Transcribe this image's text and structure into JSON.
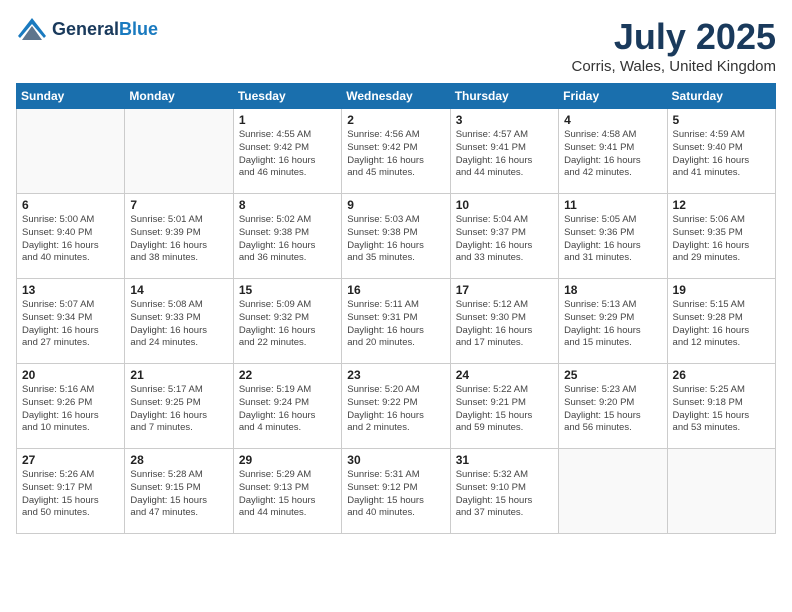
{
  "header": {
    "logo_general": "General",
    "logo_blue": "Blue",
    "month_year": "July 2025",
    "location": "Corris, Wales, United Kingdom"
  },
  "weekdays": [
    "Sunday",
    "Monday",
    "Tuesday",
    "Wednesday",
    "Thursday",
    "Friday",
    "Saturday"
  ],
  "weeks": [
    [
      {
        "day": "",
        "info": ""
      },
      {
        "day": "",
        "info": ""
      },
      {
        "day": "1",
        "info": "Sunrise: 4:55 AM\nSunset: 9:42 PM\nDaylight: 16 hours\nand 46 minutes."
      },
      {
        "day": "2",
        "info": "Sunrise: 4:56 AM\nSunset: 9:42 PM\nDaylight: 16 hours\nand 45 minutes."
      },
      {
        "day": "3",
        "info": "Sunrise: 4:57 AM\nSunset: 9:41 PM\nDaylight: 16 hours\nand 44 minutes."
      },
      {
        "day": "4",
        "info": "Sunrise: 4:58 AM\nSunset: 9:41 PM\nDaylight: 16 hours\nand 42 minutes."
      },
      {
        "day": "5",
        "info": "Sunrise: 4:59 AM\nSunset: 9:40 PM\nDaylight: 16 hours\nand 41 minutes."
      }
    ],
    [
      {
        "day": "6",
        "info": "Sunrise: 5:00 AM\nSunset: 9:40 PM\nDaylight: 16 hours\nand 40 minutes."
      },
      {
        "day": "7",
        "info": "Sunrise: 5:01 AM\nSunset: 9:39 PM\nDaylight: 16 hours\nand 38 minutes."
      },
      {
        "day": "8",
        "info": "Sunrise: 5:02 AM\nSunset: 9:38 PM\nDaylight: 16 hours\nand 36 minutes."
      },
      {
        "day": "9",
        "info": "Sunrise: 5:03 AM\nSunset: 9:38 PM\nDaylight: 16 hours\nand 35 minutes."
      },
      {
        "day": "10",
        "info": "Sunrise: 5:04 AM\nSunset: 9:37 PM\nDaylight: 16 hours\nand 33 minutes."
      },
      {
        "day": "11",
        "info": "Sunrise: 5:05 AM\nSunset: 9:36 PM\nDaylight: 16 hours\nand 31 minutes."
      },
      {
        "day": "12",
        "info": "Sunrise: 5:06 AM\nSunset: 9:35 PM\nDaylight: 16 hours\nand 29 minutes."
      }
    ],
    [
      {
        "day": "13",
        "info": "Sunrise: 5:07 AM\nSunset: 9:34 PM\nDaylight: 16 hours\nand 27 minutes."
      },
      {
        "day": "14",
        "info": "Sunrise: 5:08 AM\nSunset: 9:33 PM\nDaylight: 16 hours\nand 24 minutes."
      },
      {
        "day": "15",
        "info": "Sunrise: 5:09 AM\nSunset: 9:32 PM\nDaylight: 16 hours\nand 22 minutes."
      },
      {
        "day": "16",
        "info": "Sunrise: 5:11 AM\nSunset: 9:31 PM\nDaylight: 16 hours\nand 20 minutes."
      },
      {
        "day": "17",
        "info": "Sunrise: 5:12 AM\nSunset: 9:30 PM\nDaylight: 16 hours\nand 17 minutes."
      },
      {
        "day": "18",
        "info": "Sunrise: 5:13 AM\nSunset: 9:29 PM\nDaylight: 16 hours\nand 15 minutes."
      },
      {
        "day": "19",
        "info": "Sunrise: 5:15 AM\nSunset: 9:28 PM\nDaylight: 16 hours\nand 12 minutes."
      }
    ],
    [
      {
        "day": "20",
        "info": "Sunrise: 5:16 AM\nSunset: 9:26 PM\nDaylight: 16 hours\nand 10 minutes."
      },
      {
        "day": "21",
        "info": "Sunrise: 5:17 AM\nSunset: 9:25 PM\nDaylight: 16 hours\nand 7 minutes."
      },
      {
        "day": "22",
        "info": "Sunrise: 5:19 AM\nSunset: 9:24 PM\nDaylight: 16 hours\nand 4 minutes."
      },
      {
        "day": "23",
        "info": "Sunrise: 5:20 AM\nSunset: 9:22 PM\nDaylight: 16 hours\nand 2 minutes."
      },
      {
        "day": "24",
        "info": "Sunrise: 5:22 AM\nSunset: 9:21 PM\nDaylight: 15 hours\nand 59 minutes."
      },
      {
        "day": "25",
        "info": "Sunrise: 5:23 AM\nSunset: 9:20 PM\nDaylight: 15 hours\nand 56 minutes."
      },
      {
        "day": "26",
        "info": "Sunrise: 5:25 AM\nSunset: 9:18 PM\nDaylight: 15 hours\nand 53 minutes."
      }
    ],
    [
      {
        "day": "27",
        "info": "Sunrise: 5:26 AM\nSunset: 9:17 PM\nDaylight: 15 hours\nand 50 minutes."
      },
      {
        "day": "28",
        "info": "Sunrise: 5:28 AM\nSunset: 9:15 PM\nDaylight: 15 hours\nand 47 minutes."
      },
      {
        "day": "29",
        "info": "Sunrise: 5:29 AM\nSunset: 9:13 PM\nDaylight: 15 hours\nand 44 minutes."
      },
      {
        "day": "30",
        "info": "Sunrise: 5:31 AM\nSunset: 9:12 PM\nDaylight: 15 hours\nand 40 minutes."
      },
      {
        "day": "31",
        "info": "Sunrise: 5:32 AM\nSunset: 9:10 PM\nDaylight: 15 hours\nand 37 minutes."
      },
      {
        "day": "",
        "info": ""
      },
      {
        "day": "",
        "info": ""
      }
    ]
  ]
}
